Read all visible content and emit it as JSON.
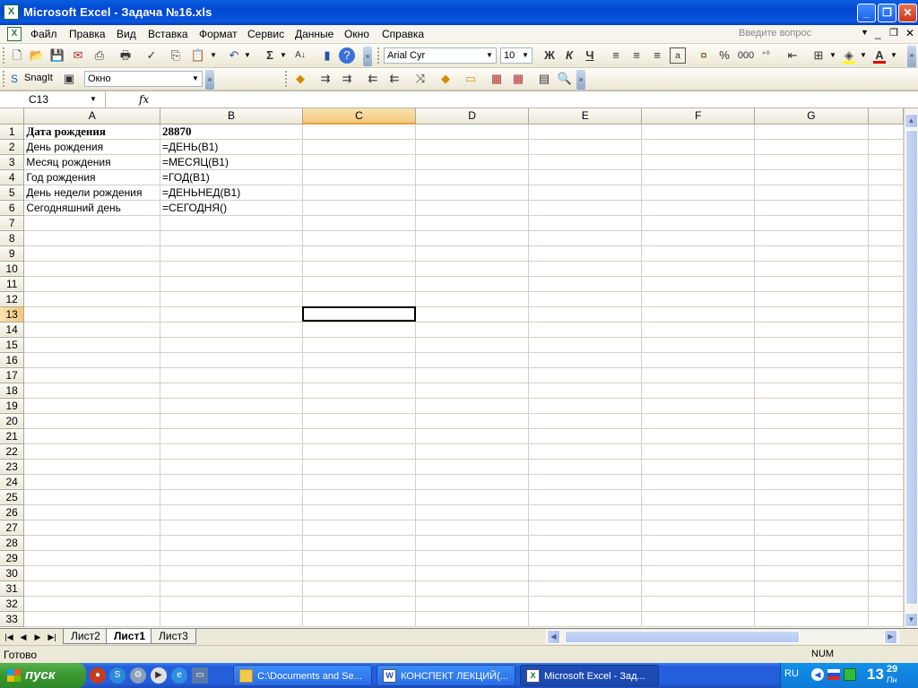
{
  "window": {
    "title": "Microsoft Excel - Задача №16.xls"
  },
  "menu": {
    "items": [
      "Файл",
      "Правка",
      "Вид",
      "Вставка",
      "Формат",
      "Сервис",
      "Данные",
      "Окно",
      "Справка"
    ],
    "ask_placeholder": "Введите вопрос"
  },
  "toolbar": {
    "font_name": "Arial Cyr",
    "font_size": "10",
    "bold_label": "Ж",
    "italic_label": "К",
    "underline_label": "Ч",
    "percent_label": "%",
    "thousands_label": "000"
  },
  "toolbar2": {
    "snagit_label": "SnagIt",
    "window_combo": "Окно"
  },
  "formula_bar": {
    "name_box": "C13",
    "fx_label": "fx",
    "content": ""
  },
  "sheet": {
    "columns": [
      "A",
      "B",
      "C",
      "D",
      "E",
      "F",
      "G"
    ],
    "selected_column": "C",
    "selected_row": 13,
    "rows": [
      {
        "n": "1",
        "a": "Дата рождения",
        "b": "28870"
      },
      {
        "n": "2",
        "a": "День рождения",
        "b": "=ДЕНЬ(B1)"
      },
      {
        "n": "3",
        "a": "Месяц рождения",
        "b": "=МЕСЯЦ(B1)"
      },
      {
        "n": "4",
        "a": "Год рождения",
        "b": "=ГОД(B1)"
      },
      {
        "n": "5",
        "a": "День недели рождения",
        "b": "=ДЕНЬНЕД(B1)"
      },
      {
        "n": "6",
        "a": "Сегодняшний день",
        "b": "=СЕГОДНЯ()"
      },
      {
        "n": "7",
        "a": "",
        "b": ""
      },
      {
        "n": "8",
        "a": "",
        "b": ""
      },
      {
        "n": "9",
        "a": "",
        "b": ""
      },
      {
        "n": "10",
        "a": "",
        "b": ""
      },
      {
        "n": "11",
        "a": "",
        "b": ""
      },
      {
        "n": "12",
        "a": "",
        "b": ""
      },
      {
        "n": "13",
        "a": "",
        "b": ""
      },
      {
        "n": "14",
        "a": "",
        "b": ""
      },
      {
        "n": "15",
        "a": "",
        "b": ""
      },
      {
        "n": "16",
        "a": "",
        "b": ""
      },
      {
        "n": "17",
        "a": "",
        "b": ""
      },
      {
        "n": "18",
        "a": "",
        "b": ""
      },
      {
        "n": "19",
        "a": "",
        "b": ""
      },
      {
        "n": "20",
        "a": "",
        "b": ""
      },
      {
        "n": "21",
        "a": "",
        "b": ""
      },
      {
        "n": "22",
        "a": "",
        "b": ""
      },
      {
        "n": "23",
        "a": "",
        "b": ""
      },
      {
        "n": "24",
        "a": "",
        "b": ""
      },
      {
        "n": "25",
        "a": "",
        "b": ""
      },
      {
        "n": "26",
        "a": "",
        "b": ""
      },
      {
        "n": "27",
        "a": "",
        "b": ""
      },
      {
        "n": "28",
        "a": "",
        "b": ""
      },
      {
        "n": "29",
        "a": "",
        "b": ""
      },
      {
        "n": "30",
        "a": "",
        "b": ""
      },
      {
        "n": "31",
        "a": "",
        "b": ""
      },
      {
        "n": "32",
        "a": "",
        "b": ""
      },
      {
        "n": "33",
        "a": "",
        "b": ""
      }
    ]
  },
  "tabs": {
    "items": [
      "Лист2",
      "Лист1",
      "Лист3"
    ],
    "active": "Лист1"
  },
  "status": {
    "left": "Готово",
    "num": "NUM"
  },
  "taskbar": {
    "start_label": "пуск",
    "tasks": [
      "C:\\Documents and Se...",
      "КОНСПЕКТ ЛЕКЦИЙ(...",
      "Microsoft Excel - Зад..."
    ],
    "active_task": 2,
    "lang": "RU",
    "clock_h": "13",
    "clock_m": "29",
    "clock_day": "Пн"
  }
}
